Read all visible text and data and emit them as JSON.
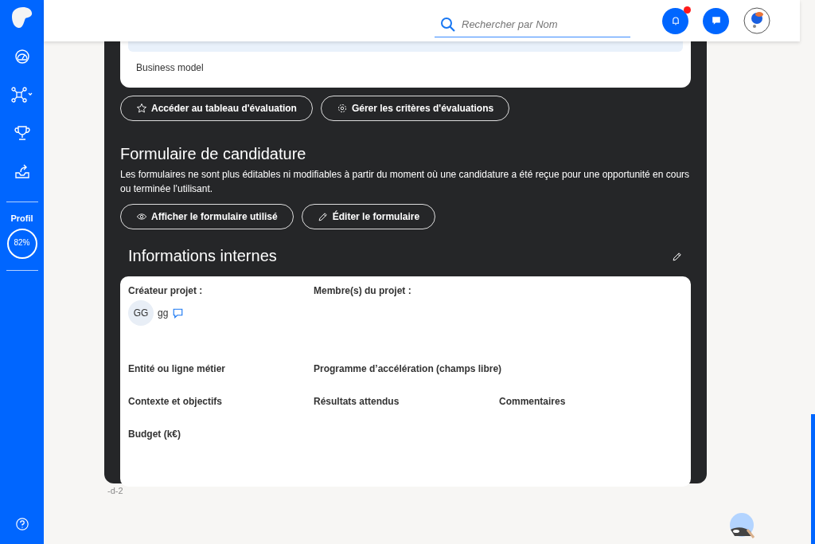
{
  "sidebar": {
    "profile_label": "Profil",
    "profile_reading": "82%"
  },
  "header": {
    "search": {
      "placeholder": "Rechercher par Nom"
    },
    "notifications": {
      "unread": true
    }
  },
  "evaluation_card": {
    "item": "Business model"
  },
  "evaluation_buttons": [
    {
      "label": "Accéder au tableau d'évaluation"
    },
    {
      "label": "Gérer les critères d'évaluations"
    }
  ],
  "application_form": {
    "title": "Formulaire de candidature",
    "description": "Les formulaires ne sont plus éditables ni modifiables à partir du moment où une candidature a été reçue pour une opportunité en cours ou terminée l’utilisant.",
    "buttons": [
      {
        "label": "Afficher le formulaire utilisé"
      },
      {
        "label": "Éditer le formulaire"
      }
    ]
  },
  "internal_info": {
    "title": "Informations internes",
    "creator": {
      "label": "Créateur projet :",
      "initials": "GG",
      "name": "gg"
    },
    "members_label": "Membre(s) du projet :",
    "field_rows": [
      [
        "Entité ou ligne métier",
        "Programme d’accélération (champs libre)"
      ],
      [
        "Contexte et objectifs",
        "Résultats attendus",
        "Commentaires"
      ],
      [
        "Budget (k€)"
      ]
    ]
  },
  "footer_code": "-d-2"
}
